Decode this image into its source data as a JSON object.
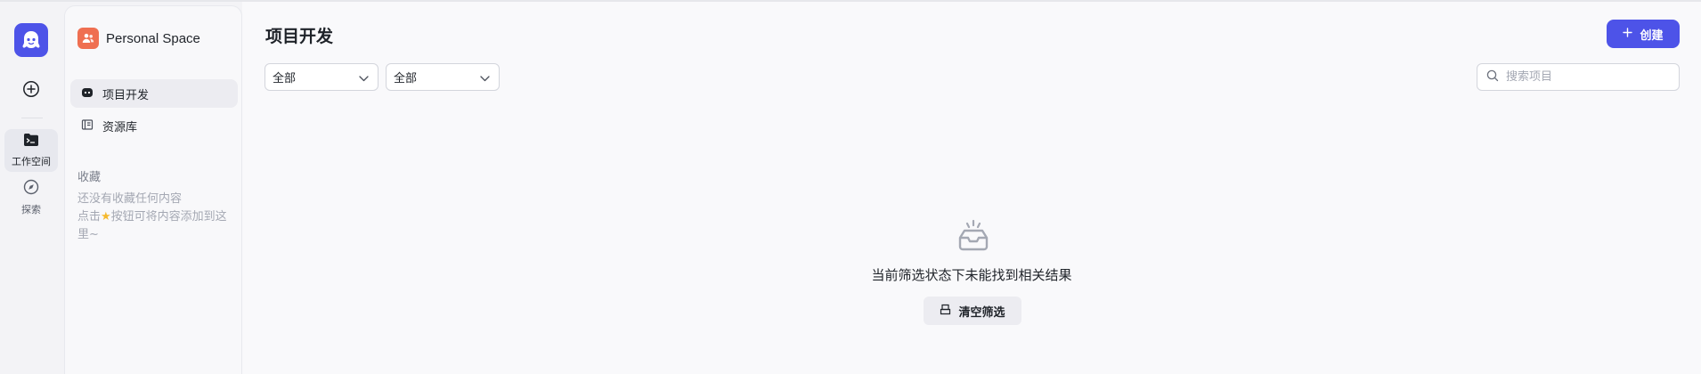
{
  "rail": {
    "workspace_label": "工作空间",
    "explore_label": "探索",
    "icons": {
      "logo": "robot-logo-icon",
      "add": "plus-circle-icon",
      "workspace": "terminal-folder-icon",
      "explore": "compass-icon"
    }
  },
  "panel": {
    "space_name": "Personal Space",
    "items": [
      {
        "label": "项目开发",
        "icon": "bot-icon",
        "active": true
      },
      {
        "label": "资源库",
        "icon": "library-icon",
        "active": false
      }
    ],
    "favorites_title": "收藏",
    "favorites_empty_line1": "还没有收藏任何内容",
    "favorites_empty_pre": "点击",
    "favorites_empty_post": "按钮可将内容添加到这里~"
  },
  "main": {
    "title": "项目开发",
    "create_label": "创建",
    "filter1_value": "全部",
    "filter2_value": "全部",
    "search_placeholder": "搜索项目",
    "empty_message": "当前筛选状态下未能找到相关结果",
    "clear_label": "清空筛选"
  },
  "colors": {
    "accent": "#4d53e8",
    "space_avatar": "#ef6f51",
    "star": "#f5b92e"
  }
}
